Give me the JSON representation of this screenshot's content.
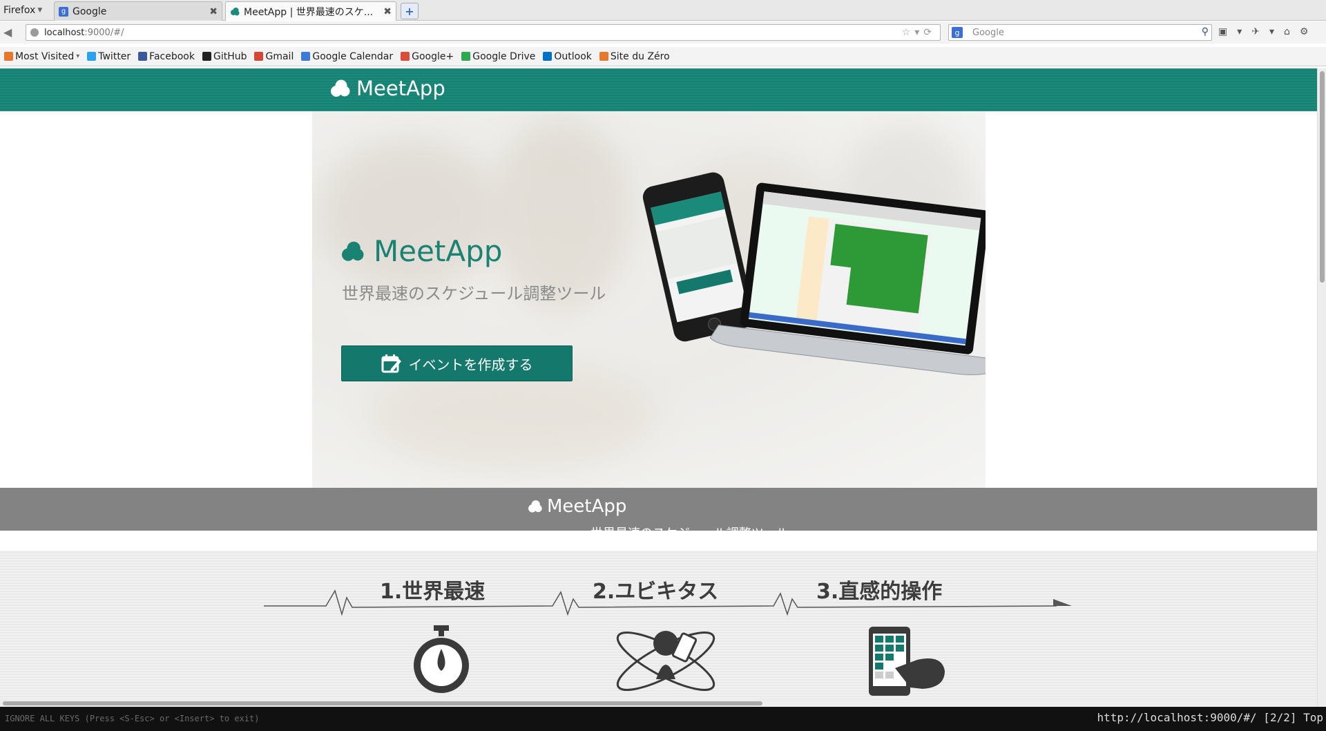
{
  "browser": {
    "menu_label": "Firefox",
    "tabs": [
      {
        "title": "Google",
        "active": false
      },
      {
        "title": "MeetApp | 世界最速のスケ...",
        "active": true
      }
    ],
    "url_host": "localhost",
    "url_path": ":9000/#/",
    "search_placeholder": "Google",
    "bookmarks": [
      {
        "label": "Most Visited",
        "icon": "most-visited-icon",
        "color": "#e8762b"
      },
      {
        "label": "Twitter",
        "icon": "twitter-icon",
        "color": "#2aa3ef"
      },
      {
        "label": "Facebook",
        "icon": "facebook-icon",
        "color": "#3b5998"
      },
      {
        "label": "GitHub",
        "icon": "github-icon",
        "color": "#222222"
      },
      {
        "label": "Gmail",
        "icon": "gmail-icon",
        "color": "#d14836"
      },
      {
        "label": "Google Calendar",
        "icon": "calendar-icon",
        "color": "#3d7ad6"
      },
      {
        "label": "Google+",
        "icon": "google-plus-icon",
        "color": "#dd4b39"
      },
      {
        "label": "Google Drive",
        "icon": "drive-icon",
        "color": "#2da94f"
      },
      {
        "label": "Outlook",
        "icon": "outlook-icon",
        "color": "#0072c6"
      },
      {
        "label": "Site du Zéro",
        "icon": "site-du-zero-icon",
        "color": "#e57a2e"
      }
    ]
  },
  "site": {
    "header_brand": "MeetApp",
    "hero_title": "MeetApp",
    "hero_subtitle": "世界最速のスケジュール調整ツール",
    "cta_label": "イベントを作成する",
    "band_brand": "MeetApp",
    "band_sub": "世界最速のスケジュール調整ツール",
    "features": [
      {
        "title": "1.世界最速",
        "icon": "stopwatch-icon"
      },
      {
        "title": "2.ユビキタス",
        "icon": "ubiquitous-atom-icon"
      },
      {
        "title": "3.直感的操作",
        "icon": "tablet-touch-icon"
      }
    ],
    "accent_color": "#1a8a7b"
  },
  "status": {
    "left": "IGNORE ALL KEYS (Press <S-Esc> or <Insert> to exit)",
    "right": "http://localhost:9000/#/ [2/2] Top"
  }
}
